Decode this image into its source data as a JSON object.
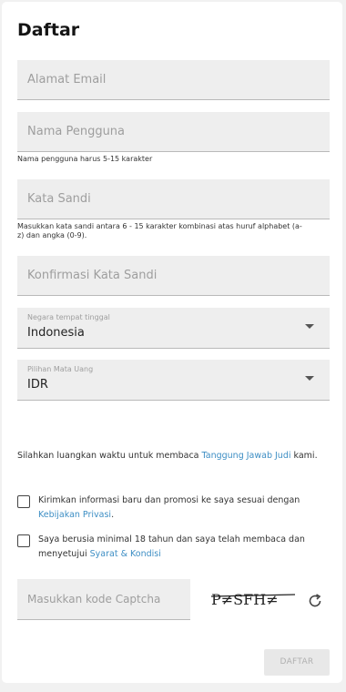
{
  "title": "Daftar",
  "fields": {
    "email_placeholder": "Alamat Email",
    "username_placeholder": "Nama Pengguna",
    "username_hint": "Nama pengguna harus 5-15 karakter",
    "password_placeholder": "Kata Sandi",
    "password_hint": "Masukkan kata sandi antara 6 - 15 karakter kombinasi atas huruf alphabet (a-z) dan angka (0-9).",
    "confirm_placeholder": "Konfirmasi Kata Sandi"
  },
  "selects": {
    "country_label": "Negara tempat tinggal",
    "country_value": "Indonesia",
    "currency_label": "Pilihan Mata Uang",
    "currency_value": "IDR"
  },
  "notice": {
    "text": "Silahkan luangkan waktu untuk membaca ",
    "link": "Tanggung Jawab Judi",
    "suffix": " kami."
  },
  "checkboxes": {
    "promo_text": "Kirimkan informasi baru dan promosi ke saya sesuai dengan ",
    "promo_link": "Kebijakan Privasi",
    "promo_suffix": ".",
    "age_text": "Saya berusia minimal 18 tahun dan saya telah membaca dan menyetujui ",
    "age_link": "Syarat & Kondisi"
  },
  "captcha": {
    "placeholder": "Masukkan kode Captcha",
    "image_text": "P≠SFH≠",
    "refresh_icon": "refresh-icon"
  },
  "submit_label": "DAFTAR",
  "colors": {
    "link": "#3d8ec4",
    "field_bg": "#eeeeee",
    "page_bg": "#f1f1f1"
  }
}
